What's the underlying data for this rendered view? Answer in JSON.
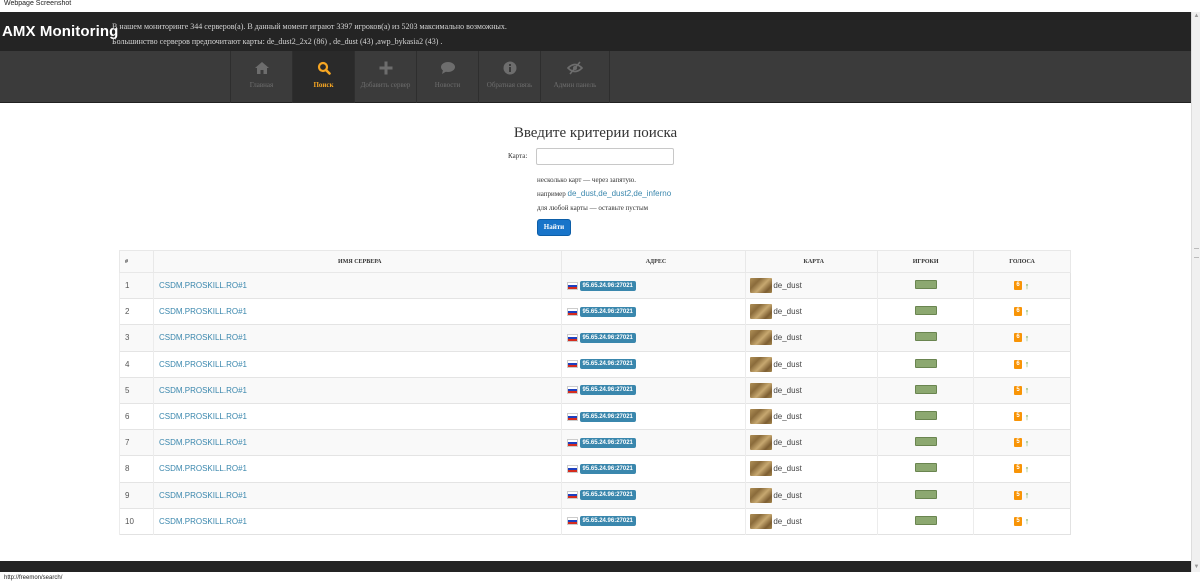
{
  "caption": "Webpage Screenshot",
  "header": {
    "brand": "AMX Monitoring",
    "stats_line1": "В нашем мониторинге 344 серверов(а). В данный момент играют 3397 игроков(а) из 5203 максимально возможных.",
    "stats_line2": "Большинство серверов предпочитают карты: de_dust2_2x2 (86) , de_dust (43) ,awp_bykasia2 (43) ."
  },
  "nav": {
    "items": [
      {
        "label": "Главная",
        "icon": "home-icon"
      },
      {
        "label": "Поиск",
        "icon": "search-icon",
        "active": true
      },
      {
        "label": "Добавить сервер",
        "icon": "plus-icon"
      },
      {
        "label": "Новости",
        "icon": "comment-icon"
      },
      {
        "label": "Обратная связь",
        "icon": "info-icon"
      },
      {
        "label": "Админ панель",
        "icon": "eye-slash-icon"
      }
    ]
  },
  "search": {
    "title": "Введите критерии поиска",
    "map_label": "Карта:",
    "map_value": "",
    "hint1": "несколько карт — через запятую.",
    "hint2_prefix": "например",
    "hint2_maps": "de_dust,de_dust2,de_inferno",
    "hint3": "для любой карты — оставьте пустым",
    "button": "Найти"
  },
  "table": {
    "headers": {
      "num": "#",
      "name": "ИМЯ СЕРВЕРА",
      "address": "АДРЕС",
      "map": "КАРТА",
      "players": "ИГРОКИ",
      "votes": "ГОЛОСА"
    },
    "rows": [
      {
        "num": "1",
        "name": "CSDM.PROSKILL.RO#1",
        "address": "95.65.24.96:27021",
        "map": "de_dust",
        "votes": "6"
      },
      {
        "num": "2",
        "name": "CSDM.PROSKILL.RO#1",
        "address": "95.65.24.96:27021",
        "map": "de_dust",
        "votes": "6"
      },
      {
        "num": "3",
        "name": "CSDM.PROSKILL.RO#1",
        "address": "95.65.24.96:27021",
        "map": "de_dust",
        "votes": "6"
      },
      {
        "num": "4",
        "name": "CSDM.PROSKILL.RO#1",
        "address": "95.65.24.96:27021",
        "map": "de_dust",
        "votes": "6"
      },
      {
        "num": "5",
        "name": "CSDM.PROSKILL.RO#1",
        "address": "95.65.24.96:27021",
        "map": "de_dust",
        "votes": "5"
      },
      {
        "num": "6",
        "name": "CSDM.PROSKILL.RO#1",
        "address": "95.65.24.96:27021",
        "map": "de_dust",
        "votes": "5"
      },
      {
        "num": "7",
        "name": "CSDM.PROSKILL.RO#1",
        "address": "95.65.24.96:27021",
        "map": "de_dust",
        "votes": "5"
      },
      {
        "num": "8",
        "name": "CSDM.PROSKILL.RO#1",
        "address": "95.65.24.96:27021",
        "map": "de_dust",
        "votes": "5"
      },
      {
        "num": "9",
        "name": "CSDM.PROSKILL.RO#1",
        "address": "95.65.24.96:27021",
        "map": "de_dust",
        "votes": "5"
      },
      {
        "num": "10",
        "name": "CSDM.PROSKILL.RO#1",
        "address": "95.65.24.96:27021",
        "map": "de_dust",
        "votes": "5"
      }
    ]
  },
  "status_url": "http://freemon/search/",
  "colors": {
    "topbar": "#242424",
    "navbar": "#3b3b3b",
    "accent": "#f6a623",
    "link": "#3a87ad",
    "button": "#1874c9",
    "vote_badge": "#f89406"
  }
}
